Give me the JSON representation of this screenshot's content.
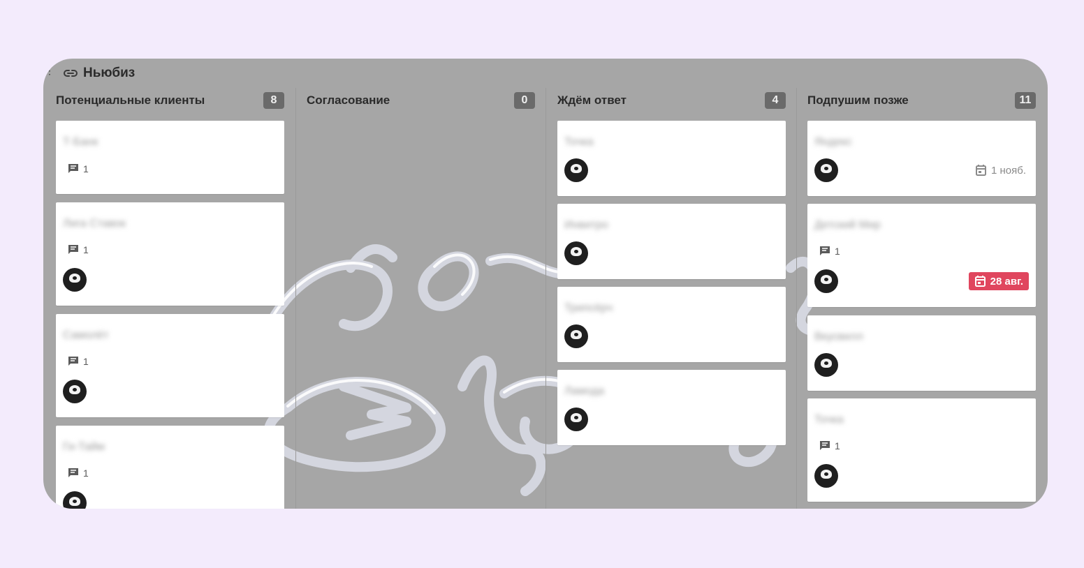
{
  "board": {
    "title": "Ньюбиз",
    "link_icon": "link-icon",
    "colors": {
      "background": "#f3ebfc",
      "board": "#a6a6a6",
      "overdue": "#e0465e"
    }
  },
  "columns": [
    {
      "title": "Потенциальные клиенты",
      "count": "8",
      "cards": [
        {
          "title": "Т-Банк",
          "comments": "1"
        },
        {
          "title": "Лига Ставок",
          "comments": "1",
          "avatar": true
        },
        {
          "title": "Самолёт",
          "comments": "1",
          "avatar": true
        },
        {
          "title": "Ги-Тайм",
          "comments": "1",
          "avatar": true
        }
      ]
    },
    {
      "title": "Согласование",
      "count": "0",
      "cards": []
    },
    {
      "title": "Ждём ответ",
      "count": "4",
      "cards": [
        {
          "title": "Точка",
          "avatar": true
        },
        {
          "title": "Инвитро",
          "avatar": true
        },
        {
          "title": "Трипсёрч",
          "avatar": true
        },
        {
          "title": "Ламода",
          "avatar": true
        }
      ]
    },
    {
      "title": "Подпушим позже",
      "count": "11",
      "cards": [
        {
          "title": "Яндекс",
          "avatar": true,
          "due": "1 нояб."
        },
        {
          "title": "Детский Мир",
          "comments": "1",
          "avatar": true,
          "due": "28 авг.",
          "overdue": true
        },
        {
          "title": "Вкусвилл",
          "avatar": true
        },
        {
          "title": "Точка",
          "comments": "1",
          "avatar": true
        }
      ]
    }
  ]
}
